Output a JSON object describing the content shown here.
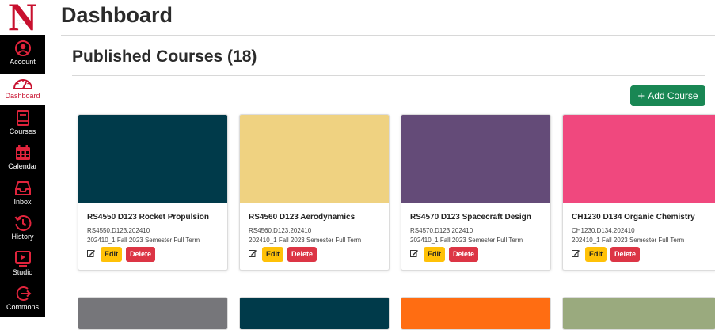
{
  "nav": {
    "logo_letter": "N",
    "items": [
      {
        "label": "Account",
        "icon": "account-icon"
      },
      {
        "label": "Dashboard",
        "icon": "dashboard-gauge-icon",
        "active": true
      },
      {
        "label": "Courses",
        "icon": "book-icon"
      },
      {
        "label": "Calendar",
        "icon": "calendar-icon"
      },
      {
        "label": "Inbox",
        "icon": "inbox-icon"
      },
      {
        "label": "History",
        "icon": "history-icon"
      },
      {
        "label": "Studio",
        "icon": "studio-icon"
      },
      {
        "label": "Commons",
        "icon": "commons-icon"
      }
    ],
    "colors": {
      "background": "#000000",
      "active_text": "#c8102e",
      "brand": "#c8102e"
    }
  },
  "header": {
    "title": "Dashboard",
    "section_title": "Published Courses (18)"
  },
  "toolbar": {
    "add_course_label": "Add Course",
    "add_course_color": "#198754"
  },
  "courses": [
    {
      "name": "RS4550 D123 Rocket Propulsion",
      "code": "RS4550.D123.202410",
      "term": "202410_1 Fall 2023 Semester Full Term",
      "color": "#003a4a",
      "edit_label": "Edit",
      "delete_label": "Delete"
    },
    {
      "name": "RS4560 D123 Aerodynamics",
      "code": "RS4560.D123.202410",
      "term": "202410_1 Fall 2023 Semester Full Term",
      "color": "#efd281",
      "edit_label": "Edit",
      "delete_label": "Delete"
    },
    {
      "name": "RS4570 D123 Spacecraft Design",
      "code": "RS4570.D123.202410",
      "term": "202410_1 Fall 2023 Semester Full Term",
      "color": "#644b78",
      "edit_label": "Edit",
      "delete_label": "Delete"
    },
    {
      "name": "CH1230 D134 Organic Chemistry",
      "code": "CH1230.D134.202410",
      "term": "202410_1 Fall 2023 Semester Full Term",
      "color": "#f0487e",
      "edit_label": "Edit",
      "delete_label": "Delete"
    }
  ],
  "next_row_colors": [
    "#76767a",
    "#003a4a",
    "#ff6d12",
    "#9aaa7e"
  ]
}
